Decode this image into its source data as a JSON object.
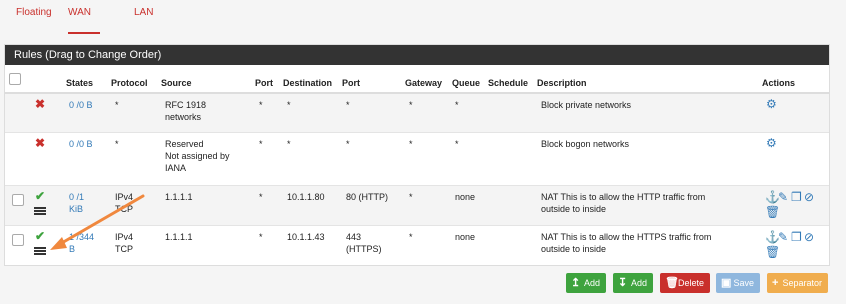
{
  "tabs": [
    {
      "label": "Floating",
      "active": false
    },
    {
      "label": "WAN",
      "active": true
    },
    {
      "label": "LAN",
      "active": false
    }
  ],
  "panel": {
    "title": "Rules (Drag to Change Order)"
  },
  "columns": [
    "States",
    "Protocol",
    "Source",
    "Port",
    "Destination",
    "Port",
    "Gateway",
    "Queue",
    "Schedule",
    "Description",
    "Actions"
  ],
  "rows": [
    {
      "status": "block",
      "states_l1": "0 /0 B",
      "states_l2": "",
      "protocol_l1": "*",
      "protocol_l2": "",
      "source": [
        "RFC 1918",
        "networks"
      ],
      "src_port": "*",
      "destination": "*",
      "dst_port_l1": "*",
      "dst_port_l2": "",
      "gateway": "*",
      "queue": "*",
      "schedule": "",
      "description": [
        "Block private networks"
      ]
    },
    {
      "status": "block",
      "states_l1": "0 /0 B",
      "states_l2": "",
      "protocol_l1": "*",
      "protocol_l2": "",
      "source": [
        "Reserved",
        "Not assigned by",
        "IANA"
      ],
      "src_port": "*",
      "destination": "*",
      "dst_port_l1": "*",
      "dst_port_l2": "",
      "gateway": "*",
      "queue": "*",
      "schedule": "",
      "description": [
        "Block bogon networks"
      ]
    },
    {
      "status": "pass",
      "states_l1": "0 /1",
      "states_l2": "KiB",
      "protocol_l1": "IPv4",
      "protocol_l2": "TCP",
      "source": [
        "1.1.1.1"
      ],
      "src_port": "*",
      "destination": "10.1.1.80",
      "dst_port_l1": "80 (HTTP)",
      "dst_port_l2": "",
      "gateway": "*",
      "queue": "none",
      "schedule": "",
      "description": [
        "NAT This is to allow the HTTP traffic from",
        "outside to inside"
      ]
    },
    {
      "status": "pass",
      "states_l1": "1 /344",
      "states_l2": "B",
      "protocol_l1": "IPv4",
      "protocol_l2": "TCP",
      "source": [
        "1.1.1.1"
      ],
      "src_port": "*",
      "destination": "10.1.1.43",
      "dst_port_l1": "443",
      "dst_port_l2": "(HTTPS)",
      "gateway": "*",
      "queue": "none",
      "schedule": "",
      "description": [
        "NAT This is to allow the HTTPS traffic from",
        "outside to inside"
      ]
    }
  ],
  "buttons": {
    "add_top": {
      "label": "Add",
      "icon": "arrow-up-icon",
      "color": "#3ea33e"
    },
    "add_bottom": {
      "label": "Add",
      "icon": "arrow-down-icon",
      "color": "#3ea33e"
    },
    "delete": {
      "label": "Delete",
      "icon": "trash-icon",
      "color": "#c9302c"
    },
    "save": {
      "label": "Save",
      "icon": "save-icon",
      "color": "#8fb7de"
    },
    "separator": {
      "label": "Separator",
      "icon": "plus-icon",
      "color": "#f0ad4e"
    }
  },
  "colors": {
    "accent": "#c9302c",
    "link": "#337ab7",
    "header": "#333333"
  }
}
